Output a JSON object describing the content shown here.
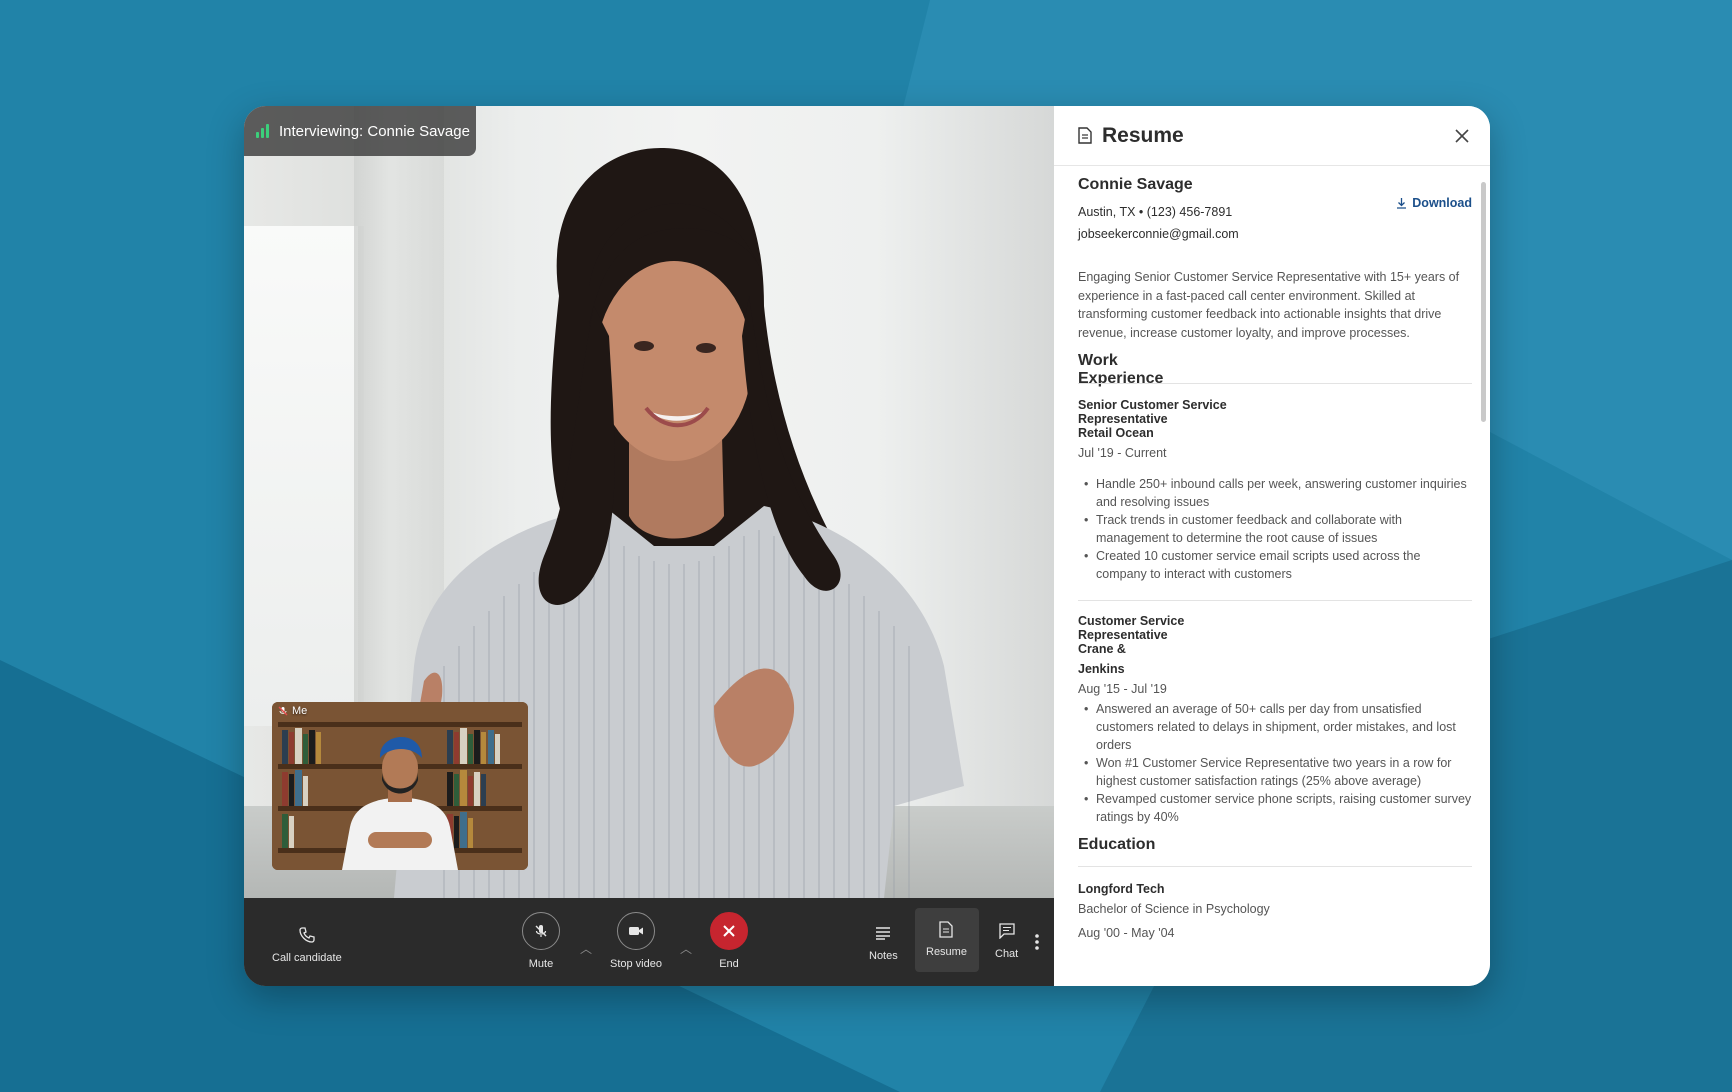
{
  "call": {
    "interviewing_label": "Interviewing: Connie Savage",
    "self_label": "Me"
  },
  "toolbar": {
    "call_candidate": "Call candidate",
    "mute": "Mute",
    "stop_video": "Stop video",
    "end": "End",
    "notes": "Notes",
    "resume": "Resume",
    "chat": "Chat"
  },
  "resume": {
    "panel_title": "Resume",
    "download_label": "Download",
    "name": "Connie Savage",
    "location_phone": "Austin, TX • (123) 456-7891",
    "email": "jobseekerconnie@gmail.com",
    "summary": "Engaging Senior Customer Service Representative with 15+ years of experience in a fast-paced call center environment. Skilled at transforming customer feedback into actionable insights that drive revenue, increase customer loyalty, and improve processes.",
    "work_heading_1": "Work",
    "work_heading_2": "Experience",
    "jobs": [
      {
        "title_1": "Senior Customer Service",
        "title_2": "Representative",
        "company": "Retail Ocean",
        "dates": "Jul '19 - Current",
        "bullets": [
          "Handle 250+ inbound calls per week, answering customer inquiries and resolving issues",
          "Track trends in customer feedback and collaborate with management to determine the root cause of issues",
          "Created 10 customer service email scripts used across the company to interact with customers"
        ]
      },
      {
        "title_1": "Customer Service",
        "title_2": "Representative",
        "company_1": "Crane &",
        "company_2": "Jenkins",
        "dates": "Aug '15 - Jul '19",
        "bullets": [
          "Answered an average of 50+ calls per day from unsatisfied customers related to delays in shipment, order mistakes, and lost orders",
          "Won #1 Customer Service Representative two years in a row for highest customer satisfaction ratings (25% above average)",
          "Revamped customer service phone scripts, raising customer survey ratings by 40%"
        ]
      }
    ],
    "education_heading": "Education",
    "school": "Longford Tech",
    "degree": "Bachelor of Science in Psychology",
    "edu_dates": "Aug '00 - May '04"
  }
}
